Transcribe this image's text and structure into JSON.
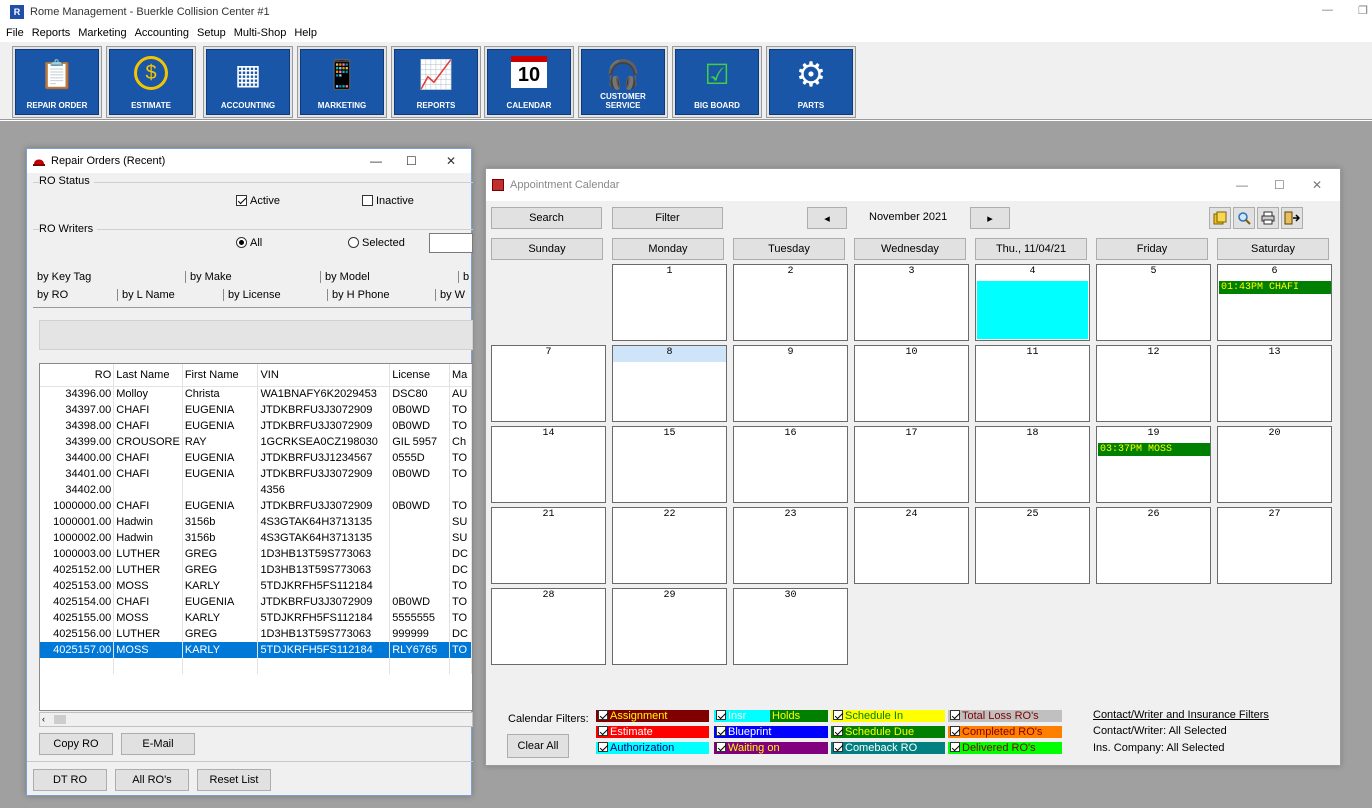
{
  "app": {
    "title": "Rome Management - Buerkle Collision Center #1",
    "icon_letter": "R",
    "min_glyph": "—",
    "max_glyph": "❐"
  },
  "menu": [
    "File",
    "Reports",
    "Marketing",
    "Accounting",
    "Setup",
    "Multi-Shop",
    "Help"
  ],
  "toolbar": [
    {
      "label": "REPAIR ORDER",
      "icon": "clipboard-icon",
      "glyph": "📋"
    },
    {
      "label": "ESTIMATE",
      "icon": "dollar-icon",
      "glyph": "$"
    },
    {
      "label": "ACCOUNTING",
      "icon": "calculator-icon",
      "glyph": "▦"
    },
    {
      "label": "MARKETING",
      "icon": "phone-icon",
      "glyph": "📱"
    },
    {
      "label": "REPORTS",
      "icon": "chart-icon",
      "glyph": "📈"
    },
    {
      "label": "CALENDAR",
      "icon": "calendar-icon",
      "glyph": "10"
    },
    {
      "label": "CUSTOMER SERVICE",
      "icon": "headset-icon",
      "glyph": "🎧"
    },
    {
      "label": "BIG BOARD",
      "icon": "checklist-icon",
      "glyph": "☑"
    },
    {
      "label": "PARTS",
      "icon": "gear-icon",
      "glyph": "⚙"
    }
  ],
  "ro_window": {
    "title": "Repair Orders (Recent)",
    "ctl_min": "—",
    "ctl_max": "☐",
    "ctl_close": "✕",
    "status_label": "RO Status",
    "active_label": "Active",
    "inactive_label": "Inactive",
    "writers_label": "RO Writers",
    "all_label": "All",
    "selected_label": "Selected",
    "tabs_row1": [
      "by Key Tag",
      "by Make",
      "by Model",
      "b"
    ],
    "tabs_row2": [
      "by RO",
      "by L Name",
      "by License",
      "by H Phone",
      "by W"
    ],
    "columns": [
      "RO",
      "Last Name",
      "First Name",
      "VIN",
      "License",
      "Ma"
    ],
    "rows": [
      [
        "34396.00",
        "Molloy",
        "Christa",
        "WA1BNAFY6K2029453",
        "DSC80",
        "AU"
      ],
      [
        "34397.00",
        "CHAFI",
        "EUGENIA",
        "JTDKBRFU3J3072909",
        "0B0WD",
        "TO"
      ],
      [
        "34398.00",
        "CHAFI",
        "EUGENIA",
        "JTDKBRFU3J3072909",
        "0B0WD",
        "TO"
      ],
      [
        "34399.00",
        "CROUSORE",
        "RAY",
        "1GCRKSEA0CZ198030",
        "GIL 5957",
        "Ch"
      ],
      [
        "34400.00",
        "CHAFI",
        "EUGENIA",
        "JTDKBRFU3J1234567",
        "0555D",
        "TO"
      ],
      [
        "34401.00",
        "CHAFI",
        "EUGENIA",
        "JTDKBRFU3J3072909",
        "0B0WD",
        "TO"
      ],
      [
        "34402.00",
        "",
        "",
        "4356",
        "",
        ""
      ],
      [
        "1000000.00",
        "CHAFI",
        "EUGENIA",
        "JTDKBRFU3J3072909",
        "0B0WD",
        "TO"
      ],
      [
        "1000001.00",
        "Hadwin",
        "3156b",
        "4S3GTAK64H3713135",
        "",
        "SU"
      ],
      [
        "1000002.00",
        "Hadwin",
        "3156b",
        "4S3GTAK64H3713135",
        "",
        "SU"
      ],
      [
        "1000003.00",
        "LUTHER",
        "GREG",
        "1D3HB13T59S773063",
        "",
        "DC"
      ],
      [
        "4025152.00",
        "LUTHER",
        "GREG",
        "1D3HB13T59S773063",
        "",
        "DC"
      ],
      [
        "4025153.00",
        "MOSS",
        "KARLY",
        "5TDJKRFH5FS112184",
        "",
        "TO"
      ],
      [
        "4025154.00",
        "CHAFI",
        "EUGENIA",
        "JTDKBRFU3J3072909",
        "0B0WD",
        "TO"
      ],
      [
        "4025155.00",
        "MOSS",
        "KARLY",
        "5TDJKRFH5FS112184",
        "5555555",
        "TO"
      ],
      [
        "4025156.00",
        "LUTHER",
        "GREG",
        "1D3HB13T59S773063",
        "999999",
        "DC"
      ],
      [
        "4025157.00",
        "MOSS",
        "KARLY",
        "5TDJKRFH5FS112184",
        "RLY6765",
        "TO"
      ]
    ],
    "selected_row": 16,
    "scroll_left": "‹",
    "btn_copy": "Copy RO",
    "btn_email": "E-Mail",
    "btn_dt": "DT RO",
    "btn_all": "All RO's",
    "btn_reset": "Reset List"
  },
  "calendar": {
    "title": "Appointment Calendar",
    "ctl_min": "—",
    "ctl_max": "☐",
    "ctl_close": "✕",
    "search": "Search",
    "filter": "Filter",
    "prev": "◂",
    "next": "▸",
    "month": "November 2021",
    "days": [
      "Sunday",
      "Monday",
      "Tuesday",
      "Wednesday",
      "Thu., 11/04/21",
      "Friday",
      "Saturday"
    ],
    "weeks": [
      [
        "",
        "1",
        "2",
        "3",
        "4",
        "5",
        "6"
      ],
      [
        "7",
        "8",
        "9",
        "10",
        "11",
        "12",
        "13"
      ],
      [
        "14",
        "15",
        "16",
        "17",
        "18",
        "19",
        "20"
      ],
      [
        "21",
        "22",
        "23",
        "24",
        "25",
        "26",
        "27"
      ],
      [
        "28",
        "29",
        "30",
        "",
        "",
        "",
        ""
      ]
    ],
    "appointments": [
      {
        "day": "6",
        "text": "01:43PM   CHAFI"
      },
      {
        "day": "19",
        "text": "03:37PM   MOSS"
      }
    ],
    "filters_label": "Calendar Filters:",
    "clear_all": "Clear All",
    "filters": [
      {
        "label": "Assignment",
        "bg": "#800000",
        "fg": "#ffff00"
      },
      {
        "label": "Estimate",
        "bg": "#ff0000",
        "fg": "#ffffff"
      },
      {
        "label": "Authorization",
        "bg": "#00ffff",
        "fg": "#000080"
      },
      {
        "label": "Insr",
        "bg": "#00ffff",
        "fg": "#ffffff"
      },
      {
        "label": "Holds",
        "bg": "#008000",
        "fg": "#ffff00"
      },
      {
        "label": "Blueprint",
        "bg": "#0000ff",
        "fg": "#ffffff"
      },
      {
        "label": "Waiting on",
        "bg": "#800080",
        "fg": "#ffff00"
      },
      {
        "label": "Schedule In",
        "bg": "#ffff00",
        "fg": "#008000"
      },
      {
        "label": "Schedule Due",
        "bg": "#008000",
        "fg": "#ffff00"
      },
      {
        "label": "Comeback RO",
        "bg": "#008080",
        "fg": "#ffffff"
      },
      {
        "label": "Total Loss RO's",
        "bg": "#c0c0c0",
        "fg": "#800000"
      },
      {
        "label": "Completed RO's",
        "bg": "#ff8000",
        "fg": "#800000"
      },
      {
        "label": "Delivered RO's",
        "bg": "#00ff00",
        "fg": "#800000"
      }
    ],
    "contact_filters_link": "Contact/Writer and Insurance Filters",
    "contact_writer": "Contact/Writer: All Selected",
    "ins_company": "Ins. Company:  All Selected"
  }
}
